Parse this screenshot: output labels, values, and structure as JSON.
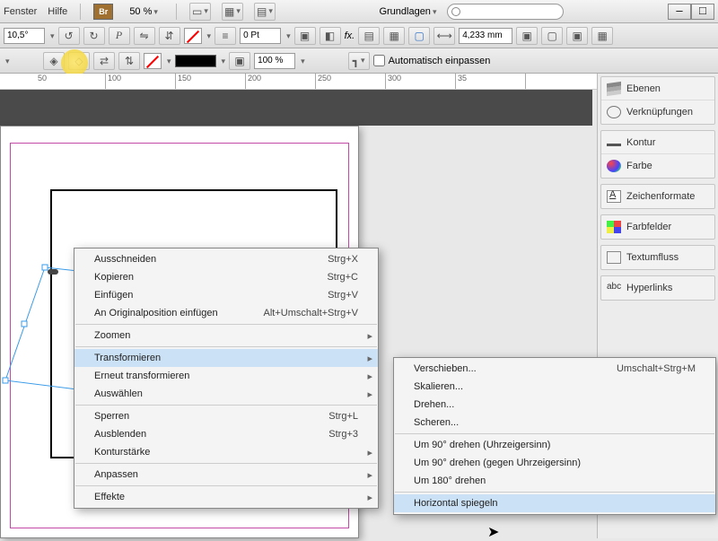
{
  "topmenu": {
    "fenster": "Fenster",
    "hilfe": "Hilfe"
  },
  "zoom": "50 %",
  "workspace_preset": "Grundlagen",
  "angle": "10,5°",
  "stroke_pt": "0 Pt",
  "opacity": "100 %",
  "measure": "4,233 mm",
  "autofit": "Automatisch einpassen",
  "ruler": {
    "r0": "50",
    "r1": "100",
    "r2": "150",
    "r3": "200",
    "r4": "250",
    "r5": "300",
    "r6": "35"
  },
  "panels": {
    "ebenen": "Ebenen",
    "verknuepfungen": "Verknüpfungen",
    "kontur": "Kontur",
    "farbe": "Farbe",
    "zeichenformate": "Zeichenformate",
    "farbfelder": "Farbfelder",
    "textumfluss": "Textumfluss",
    "hyperlinks": "Hyperlinks"
  },
  "ctx": {
    "ausschneiden": "Ausschneiden",
    "k_x": "Strg+X",
    "kopieren": "Kopieren",
    "k_c": "Strg+C",
    "einfuegen": "Einfügen",
    "k_v": "Strg+V",
    "orig": "An Originalposition einfügen",
    "k_orig": "Alt+Umschalt+Strg+V",
    "zoomen": "Zoomen",
    "transformieren": "Transformieren",
    "erneut": "Erneut transformieren",
    "auswaehlen": "Auswählen",
    "sperren": "Sperren",
    "k_l": "Strg+L",
    "ausblenden": "Ausblenden",
    "k_3": "Strg+3",
    "konturstaerke": "Konturstärke",
    "anpassen": "Anpassen",
    "effekte": "Effekte"
  },
  "sub": {
    "verschieben": "Verschieben...",
    "k_v": "Umschalt+Strg+M",
    "skalieren": "Skalieren...",
    "drehen": "Drehen...",
    "scheren": "Scheren...",
    "d90c": "Um 90° drehen (Uhrzeigersinn)",
    "d90cc": "Um 90° drehen (gegen Uhrzeigersinn)",
    "d180": "Um 180° drehen",
    "hspiegel": "Horizontal spiegeln"
  }
}
